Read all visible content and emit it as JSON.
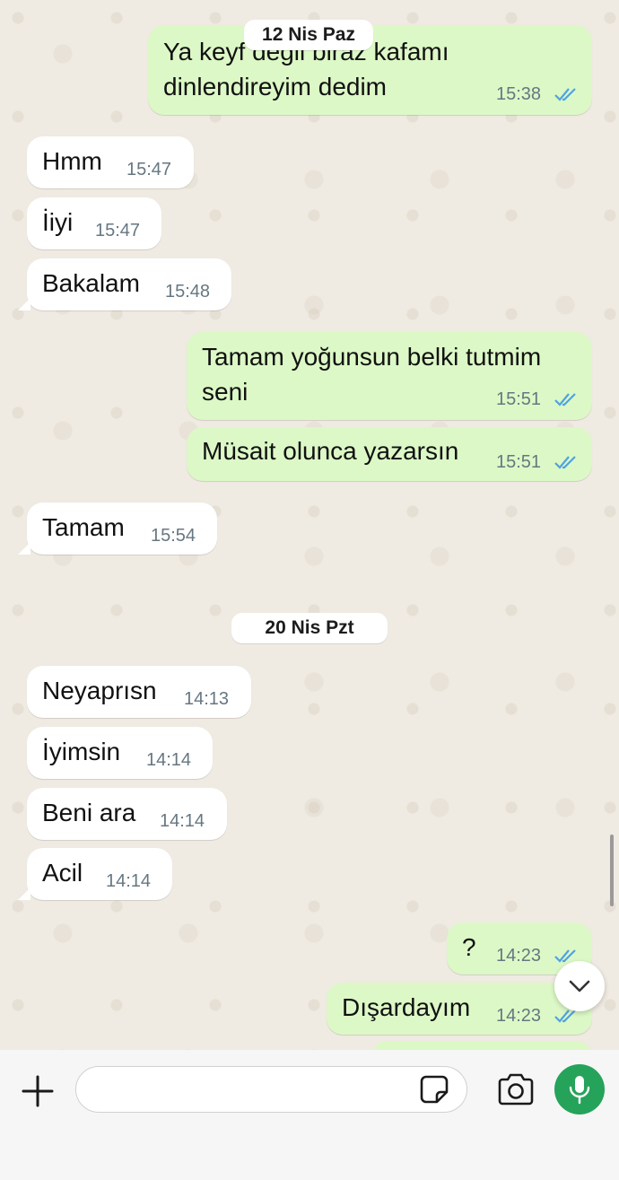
{
  "dates": {
    "d1": "12 Nis Paz",
    "d2": "20 Nis Pzt"
  },
  "messages": [
    {
      "dir": "out",
      "text": "Ya keyf değil biraz kafamı dinlendireyim dedim",
      "time": "15:38",
      "read": true
    },
    {
      "dir": "in",
      "text": "Hmm",
      "time": "15:47"
    },
    {
      "dir": "in",
      "text": "İiyi",
      "time": "15:47"
    },
    {
      "dir": "in",
      "text": "Bakalam",
      "time": "15:48"
    },
    {
      "dir": "out",
      "text": "Tamam yoğunsun belki tutmim seni",
      "time": "15:51",
      "read": true
    },
    {
      "dir": "out",
      "text": "Müsait olunca yazarsın",
      "time": "15:51",
      "read": true
    },
    {
      "dir": "in",
      "text": "Tamam",
      "time": "15:54"
    },
    {
      "dir": "in",
      "text": "Neyaprısn",
      "time": "14:13"
    },
    {
      "dir": "in",
      "text": "İyimsin",
      "time": "14:14"
    },
    {
      "dir": "in",
      "text": "Beni ara",
      "time": "14:14"
    },
    {
      "dir": "in",
      "text": "Acil",
      "time": "14:14"
    },
    {
      "dir": "out",
      "text": "?",
      "time": "14:23",
      "read": true
    },
    {
      "dir": "out",
      "text": "Dışardayım",
      "time": "14:23",
      "read": true
    }
  ],
  "icons": {
    "read_receipt": "double-check-icon",
    "scroll": "chevron-down-icon",
    "attach": "plus-icon",
    "sticker": "sticker-icon",
    "camera": "camera-icon",
    "mic": "microphone-icon"
  },
  "colors": {
    "outgoing_bubble": "#dcf8c6",
    "incoming_bubble": "#ffffff",
    "read_ticks": "#4fa3e0",
    "mic_button": "#25a35a",
    "background": "#efeae2"
  },
  "input": {
    "placeholder": ""
  }
}
